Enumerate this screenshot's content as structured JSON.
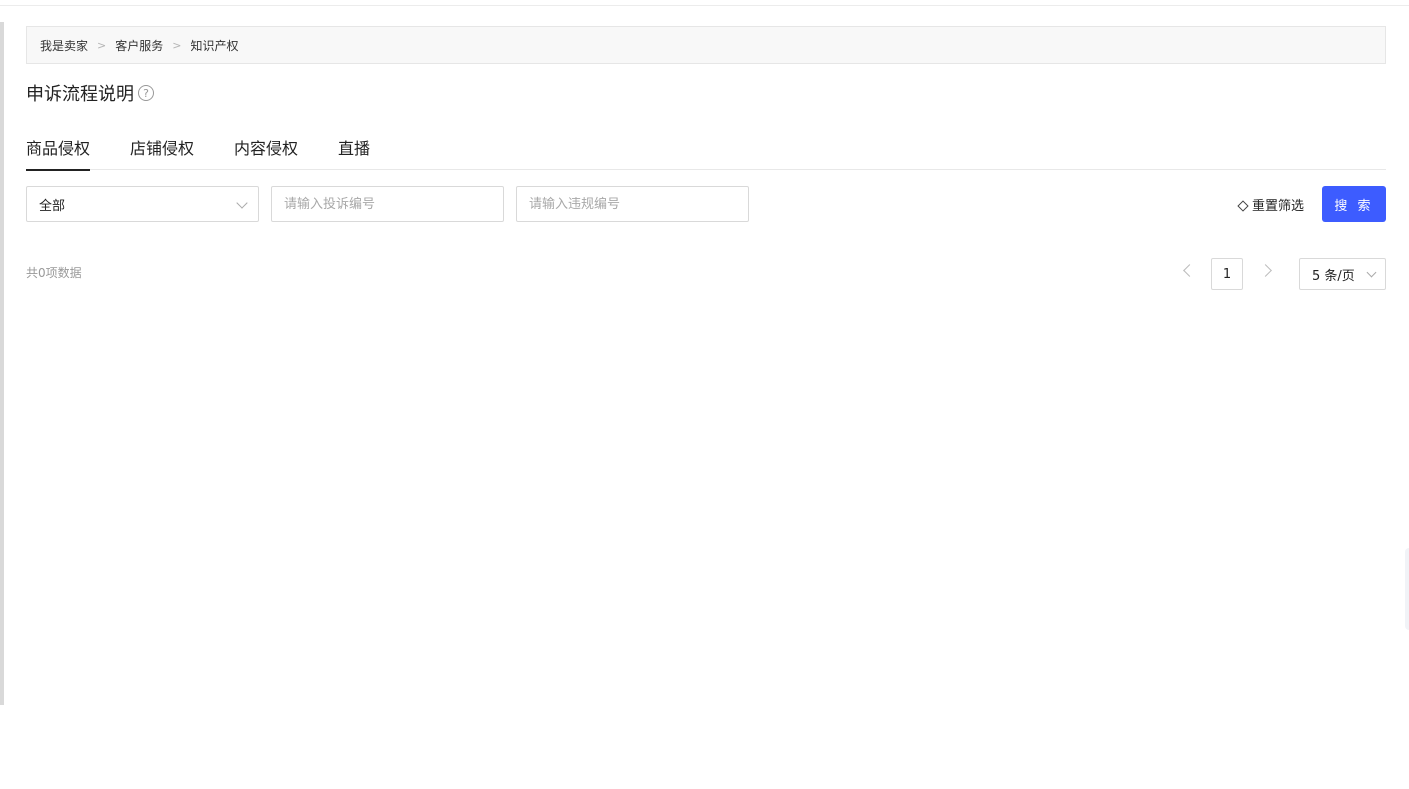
{
  "breadcrumb": {
    "items": [
      "我是卖家",
      "客户服务",
      "知识产权"
    ],
    "separator": ">"
  },
  "header": {
    "title": "申诉流程说明",
    "help_icon": "question-circle-icon"
  },
  "tabs": [
    {
      "label": "商品侵权",
      "active": true
    },
    {
      "label": "店铺侵权",
      "active": false
    },
    {
      "label": "内容侵权",
      "active": false
    },
    {
      "label": "直播",
      "active": false
    }
  ],
  "filters": {
    "status_select": {
      "value": "全部"
    },
    "complaint_input": {
      "placeholder": "请输入投诉编号",
      "value": ""
    },
    "violation_input": {
      "placeholder": "请输入违规编号",
      "value": ""
    },
    "reset_label": "重置筛选",
    "reset_icon": "eraser-icon",
    "search_label": "搜 索"
  },
  "results": {
    "total_text": "共0项数据"
  },
  "pagination": {
    "current_page": "1",
    "page_size": "5 条/页"
  },
  "colors": {
    "primary": "#3d5cff",
    "tab_active": "#222222",
    "placeholder": "#a8a8a8"
  }
}
